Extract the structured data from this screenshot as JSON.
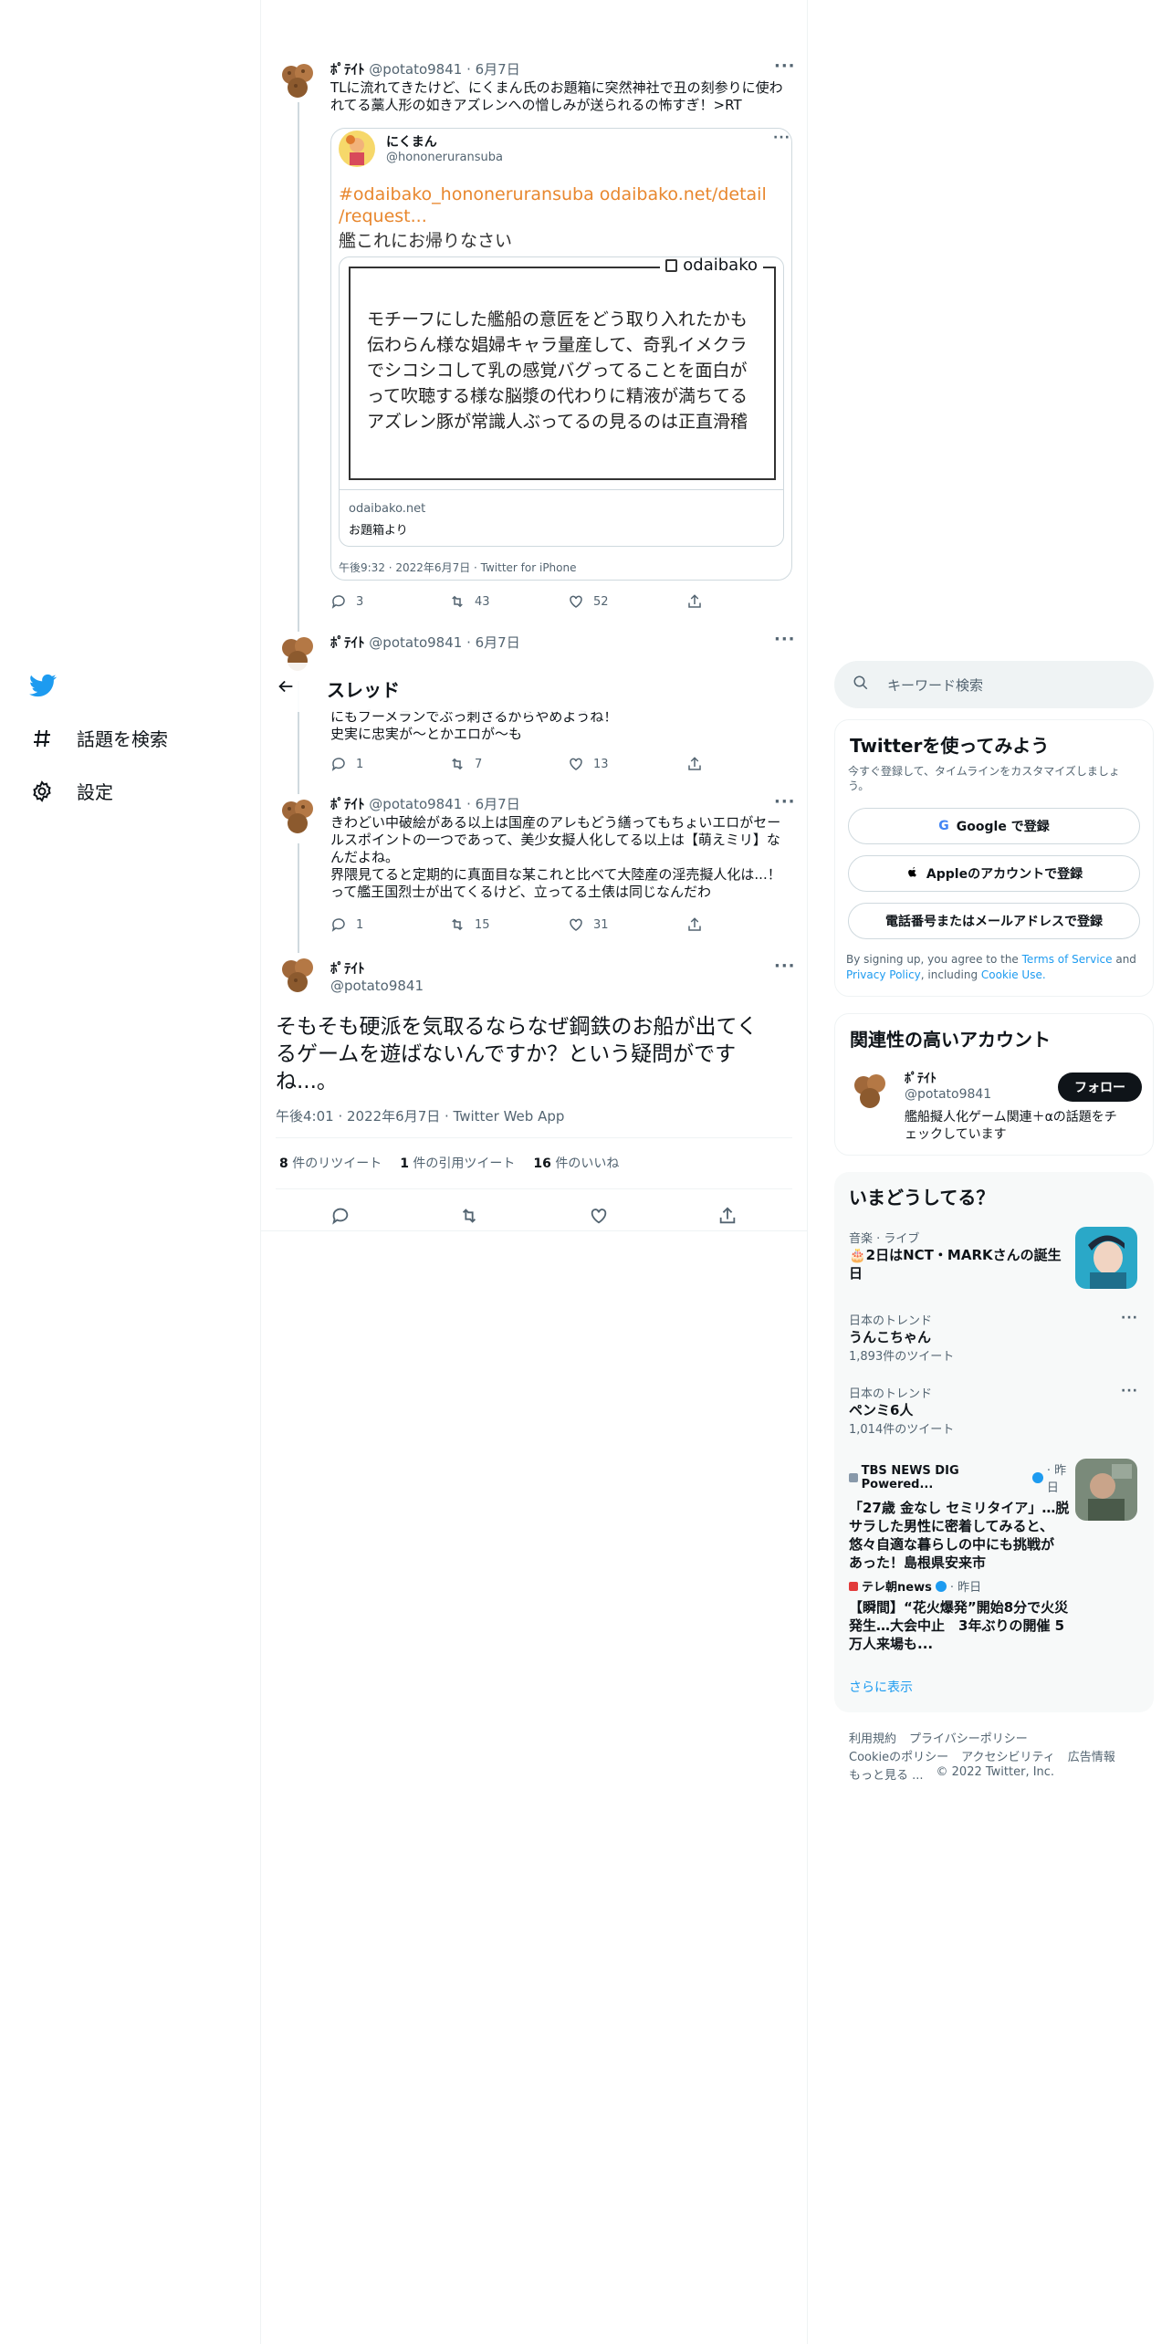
{
  "nav": {
    "explore_label": "話題を検索",
    "settings_label": "設定"
  },
  "header": {
    "title": "スレッド"
  },
  "tweets": [
    {
      "name": "ﾎﾟﾃｲﾄ",
      "meta": "@potato9841 · 6月7日",
      "text_lines": [
        "TLに流れてきたけど、にくまん氏のお題箱に突然神社で丑の刻参りに使わ",
        "れてる藁人形の如きアズレンへの憎しみが送られるの怖すぎ！>RT"
      ],
      "quote": {
        "name": "にくまん",
        "handle": "@hononeruransuba",
        "link_text": "#odaibako_hononeruransuba odaibako.net/detail/request...",
        "link_line1": "#odaibako_hononeruransuba odaibako.net/detail",
        "link_line2": "/request...",
        "text": "艦これにお帰りなさい",
        "card_brand": "odaibako",
        "card_lines": [
          "モチーフにした艦船の意匠をどう取り入れたかも",
          "伝わらん様な娼婦キャラ量産して、奇乳イメクラ",
          "でシコシコして乳の感覚バグってることを面白が",
          "って吹聴する様な脳漿の代わりに精液が満ちてる",
          "アズレン豚が常識人ぶってるの見るのは正直滑稽"
        ],
        "card_domain": "odaibako.net",
        "card_desc": "お題箱より",
        "time": "午後9:32 · 2022年6月7日 · Twitter for iPhone"
      },
      "replies": "3",
      "retweets": "43",
      "likes": "52"
    },
    {
      "name": "ﾎﾟﾃｲﾄ",
      "meta": "@potato9841 · 6月7日",
      "text_lines": [
        "にもブーメランでぶっ刺さるからやめようね！",
        "史実に忠実が～とかエロが～も"
      ],
      "replies": "1",
      "retweets": "7",
      "likes": "13"
    },
    {
      "name": "ﾎﾟﾃｲﾄ",
      "meta": "@potato9841 · 6月7日",
      "text_lines": [
        "きわどい中破絵がある以上は国産のアレもどう繕ってもちょいエロがセー",
        "ルスポイントの一つであって、美少女擬人化してる以上は【萌えミリ】な",
        "んだよね。",
        "界隈見てると定期的に真面目な某これと比べて大陸産の淫売擬人化は...！",
        "って艦王国烈士が出てくるけど、立ってる土俵は同じなんだわ"
      ],
      "replies": "1",
      "retweets": "15",
      "likes": "31"
    }
  ],
  "main_tweet": {
    "name": "ﾎﾟﾃｲﾄ",
    "handle": "@potato9841",
    "text_lines": [
      "そもそも硬派を気取るならなぜ鋼鉄のお船が出てく",
      "るゲームを遊ばないんですか？という疑問がです",
      "ね...。"
    ],
    "time": "午後4:01 · 2022年6月7日 · Twitter Web App",
    "retweet_count": "8",
    "retweet_label": " 件のリツイート",
    "quote_count": "1",
    "quote_label": " 件の引用ツイート",
    "like_count": "16",
    "like_label": " 件のいいね"
  },
  "search": {
    "placeholder": "キーワード検索"
  },
  "signup": {
    "title": "Twitterを使ってみよう",
    "subtitle": "今すぐ登録して、タイムラインをカスタマイズしましょう。",
    "google": "Google で登録",
    "apple": "Appleのアカウントで登録",
    "phone": "電話番号またはメールアドレスで登録",
    "terms_pre": "By signing up, you agree to the ",
    "terms_link": "Terms of Service",
    "terms_and": " and",
    "privacy_link": "Privacy Policy",
    "including": ", including ",
    "cookie_link": "Cookie Use."
  },
  "relevant": {
    "title": "関連性の高いアカウント",
    "name": "ﾎﾟﾃｲﾄ",
    "handle": "@potato9841",
    "follow": "フォロー",
    "bio_line1": "艦船擬人化ゲーム関連＋αの話題をチ",
    "bio_line2": "ェックしています"
  },
  "trends": {
    "title": "いまどうしてる？",
    "items": [
      {
        "cat": "音楽 · ライブ",
        "title_line1": "🎂2日はNCT・MARKさんの誕生",
        "title_line2": "日"
      },
      {
        "cat": "日本のトレンド",
        "title": "うんこちゃん",
        "count": "1,893件のツイート"
      },
      {
        "cat": "日本のトレンド",
        "title": "ペンミ6人",
        "count": "1,014件のツイート"
      },
      {
        "src": "TBS NEWS DIG Powered...",
        "time": "· 昨日",
        "lines": [
          "「27歳 金なし セミリタイア」…脱",
          "サラした男性に密着してみると、",
          "悠々自適な暮らしの中にも挑戦が",
          "あった！島根県安来市"
        ]
      },
      {
        "src": "テレ朝news",
        "time": "· 昨日",
        "lines": [
          "【瞬間】“花火爆発”開始8分で火災",
          "発生…大会中止　3年ぶりの開催 5",
          "万人来場も..."
        ]
      }
    ],
    "more": "さらに表示"
  },
  "footer": {
    "line1": [
      "利用規約",
      "プライバシーポリシー"
    ],
    "line2": [
      "Cookieのポリシー",
      "アクセシビリティ",
      "広告情報"
    ],
    "more": "もっと見る ...",
    "copyright": "© 2022 Twitter, Inc."
  },
  "colors": {
    "accent": "#1d9bf0",
    "link_orange": "#e8872e",
    "border": "#eff3f4",
    "text_secondary": "#536471"
  }
}
